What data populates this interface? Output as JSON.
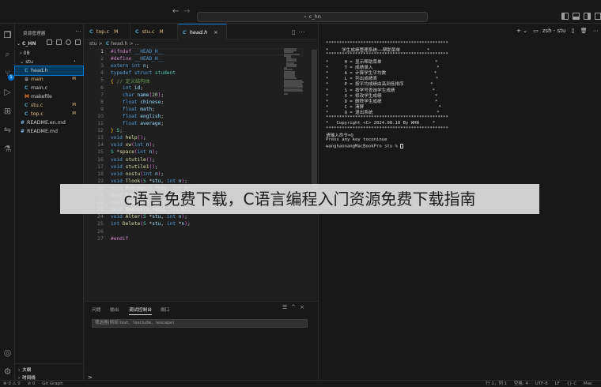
{
  "title_bar": {
    "command_center": "c_hn"
  },
  "sidebar": {
    "title": "资源管理器",
    "root": "C_HN",
    "items": [
      {
        "label": "08",
        "type": "folder",
        "depth": 1,
        "decoration": ""
      },
      {
        "label": "stu",
        "type": "folder",
        "depth": 1,
        "decoration": "dot"
      },
      {
        "label": "head.h",
        "type": "c",
        "depth": 2,
        "decoration": "U"
      },
      {
        "label": "main",
        "type": "c",
        "depth": 2,
        "decoration": "M"
      },
      {
        "label": "main.c",
        "type": "c",
        "depth": 2,
        "decoration": ""
      },
      {
        "label": "makefile",
        "type": "m",
        "depth": 2,
        "decoration": ""
      },
      {
        "label": "stu.c",
        "type": "c",
        "depth": 2,
        "decoration": "M"
      },
      {
        "label": "top.c",
        "type": "c",
        "depth": 2,
        "decoration": "M"
      },
      {
        "label": "README.en.md",
        "type": "md",
        "depth": 1,
        "decoration": ""
      },
      {
        "label": "README.md",
        "type": "md",
        "depth": 1,
        "decoration": ""
      }
    ],
    "outline": "大纲",
    "timeline": "时间线"
  },
  "tabs": [
    {
      "label": "top.c",
      "decoration": "M"
    },
    {
      "label": "stu.c",
      "decoration": "M"
    },
    {
      "label": "head.h",
      "decoration": ""
    }
  ],
  "breadcrumb": {
    "folder": "stu",
    "sep": ">",
    "file": "head.h",
    "more": "> ..."
  },
  "editor": {
    "current_line": 1,
    "lines": [
      "#ifndef __HEAD_H__",
      "#define __HEAD_H__",
      "extern int n;",
      "typedef struct student",
      "{ // 定义结构体",
      "    int id;",
      "    char name[20];",
      "    float chinese;",
      "    float math;",
      "    float english;",
      "    float average;",
      "} S;",
      "void help();",
      "void xw(int n);",
      "S *space(int n);",
      "void stutile();",
      "void stutile1();",
      "void nostu(int n);",
      "void Tlook(S *stu, int n);",
      "void Average(S *stu, int n);",
      "void Sort(S *stu, int n);",
      "void Search(S *stu, int n);",
      "void Search(S *stu, int n);",
      "void Alter(S *stu, int n);",
      "int Delete(S *stu, int *n);",
      "",
      "#endif"
    ]
  },
  "panel": {
    "tabs": [
      "问题",
      "输出",
      "调试控制台",
      "端口"
    ],
    "filter_placeholder": "筛选器(例如 text、!exclude、\\escape)",
    "prompt": ">"
  },
  "terminal": {
    "shell_label": "zsh - stu",
    "lines": [
      "**********************************************",
      "*     学生成绩管理系统——帮助菜单          *",
      "**********************************************",
      "*      H = 显示帮助菜单                    *",
      "*      T = 成绩录入                        *",
      "*      A = 计算学生平均数                  *",
      "*      L = 列出成绩表                      *",
      "*      P = 按平均成绩由高到低排序          *",
      "*      S = 按学号查询学生成绩              *",
      "*      X = 修改学生成绩                    *",
      "*      D = 删除学生成绩                    *",
      "*      C = 清屏                            *",
      "*      Q = 退出系统                        *",
      "**********************************************",
      "*   Copyright <C> 2024.08.10 By WHN     *",
      "**********************************************",
      "请输入命令=Q",
      "Press any key toconinue",
      "wanghaonan@MacBookPro stu % "
    ]
  },
  "banner": {
    "text": "c语言免费下载，C语言编程入门资源免费下载指南"
  },
  "statusbar": {
    "left": [
      "⊗ 0 ⚠ 0",
      "⊘ 0",
      "Git Graph"
    ],
    "right": [
      "行 1，列 1",
      "空格: 4",
      "UTF-8",
      "LF",
      "{} C",
      "Mac"
    ]
  },
  "colors": {
    "accent": "#0078d4",
    "background": "#1e1e1e"
  }
}
